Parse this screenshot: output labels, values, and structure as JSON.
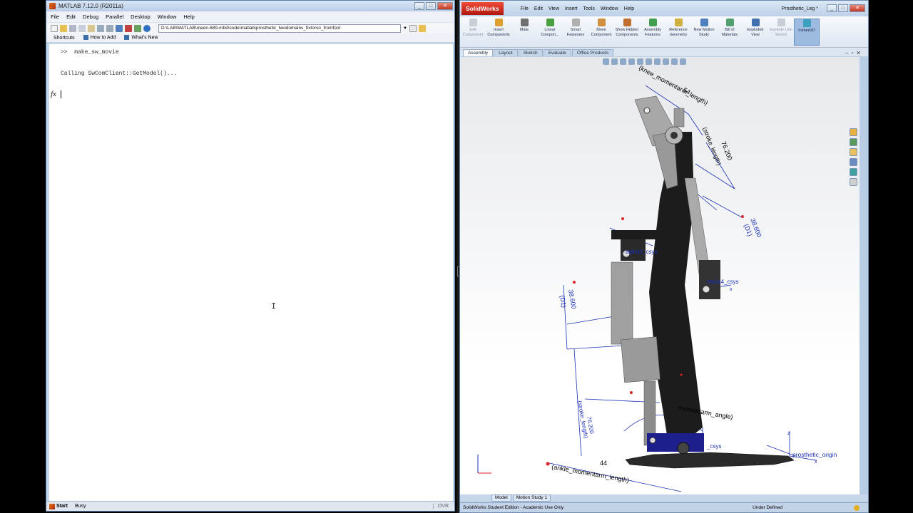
{
  "matlab": {
    "title": "MATLAB  7.12.0 (R2011a)",
    "menu": [
      "File",
      "Edit",
      "Debug",
      "Parallel",
      "Desktop",
      "Window",
      "Help"
    ],
    "current_folder": "D:\\LAB\\MATLAB\\meen-689-mbd\\code\\matlab\\prosthetic_twodomains_fixtorso_fromfoot",
    "shortcuts": [
      "Shortcuts",
      "How to Add",
      "What's New"
    ],
    "command_window": {
      "line1": ">>  make_sw_movie",
      "line2": "Calling SwComClient::GetModel()...",
      "prompt_symbol": "fx"
    },
    "status": {
      "start_label": "Start",
      "busy_label": "Busy",
      "ovr_label": "OVR"
    }
  },
  "solidworks": {
    "logo_text": "SolidWorks",
    "menu": [
      "File",
      "Edit",
      "View",
      "Insert",
      "Tools",
      "Window",
      "Help"
    ],
    "document_name": "Prosthetic_Leg *",
    "commands": [
      {
        "label": "Edit Component",
        "icon": "edit-component-icon",
        "enabled": false
      },
      {
        "label": "Insert Components",
        "icon": "insert-components-icon",
        "enabled": true
      },
      {
        "label": "Mate",
        "icon": "mate-icon",
        "enabled": true
      },
      {
        "label": "Linear Compon...",
        "icon": "linear-pattern-icon",
        "enabled": true
      },
      {
        "label": "Smart Fasteners",
        "icon": "smart-fasteners-icon",
        "enabled": true
      },
      {
        "label": "Move Component",
        "icon": "move-component-icon",
        "enabled": true
      },
      {
        "label": "Show Hidden Components",
        "icon": "show-hidden-icon",
        "enabled": true
      },
      {
        "label": "Assembly Features",
        "icon": "assembly-features-icon",
        "enabled": true
      },
      {
        "label": "Reference Geometry",
        "icon": "reference-geometry-icon",
        "enabled": true
      },
      {
        "label": "New Motion Study",
        "icon": "motion-study-icon",
        "enabled": true
      },
      {
        "label": "Bill of Materials",
        "icon": "bom-icon",
        "enabled": true
      },
      {
        "label": "Exploded View",
        "icon": "exploded-view-icon",
        "enabled": true
      },
      {
        "label": "Explode Line Sketch",
        "icon": "explode-line-icon",
        "enabled": false
      },
      {
        "label": "Instant3D",
        "icon": "instant3d-icon",
        "enabled": true,
        "active": true
      }
    ],
    "command_tabs": [
      "Assembly",
      "Layout",
      "Sketch",
      "Evaluate",
      "Office Products"
    ],
    "active_command_tab": "Assembly",
    "dimensions": {
      "knee_momentarm_length": "(knee_momentarm_length)",
      "knee_value": "54",
      "stroke_length_top": "(stroke_length)",
      "stroke_value_top": "76.200",
      "d1_top": "(D1)",
      "d1_top_value": "38.600",
      "d1_left": "(D1)",
      "d1_left_value": "38.600",
      "stroke_length_bottom": "(stroke_length)",
      "stroke_value_bottom": "76.200",
      "momentarm_angle": "momentarm_angle)",
      "ankle_momentarm_length": "(ankle_momentarm_length)",
      "ankle_value": "44",
      "alpha3_label": "alpha3_csys",
      "alpha4_label": "alpha4_csys",
      "csys_label": "_csys",
      "origin_label": "prosthetic_origin",
      "axis_z": "z",
      "axis_x": "x"
    },
    "bottom_tabs": [
      "Model",
      "Motion Study 1"
    ],
    "status_left": "SolidWorks Student Edition - Academic Use Only",
    "status_right": "Under Defined",
    "colors": {
      "dimension_blue": "#1a2fb8",
      "part_black": "#1c1c1c",
      "part_gray": "#8a8a8a"
    }
  }
}
